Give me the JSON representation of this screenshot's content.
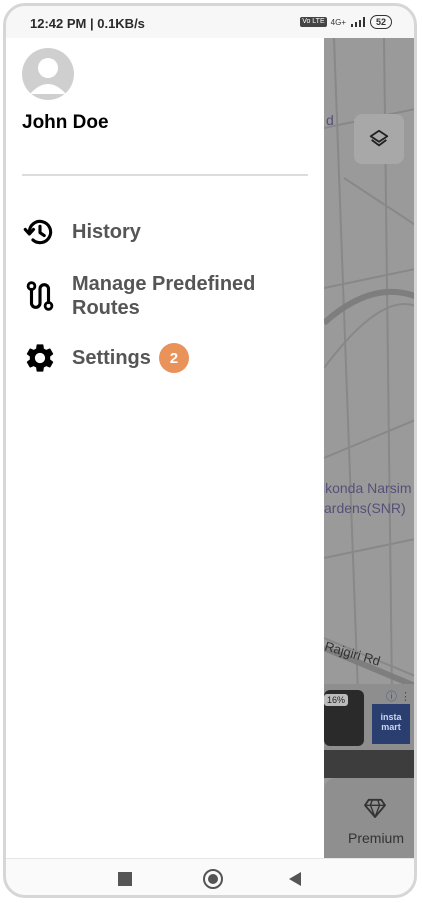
{
  "status_bar": {
    "time_speed": "12:42 PM | 0.1KB/s",
    "volte": "Vo LTE",
    "network": "4G+",
    "battery": "52"
  },
  "drawer": {
    "user_name": "John Doe",
    "menu": [
      {
        "label": "History",
        "icon": "history-icon"
      },
      {
        "label": "Manage Predefined Routes",
        "icon": "route-icon"
      },
      {
        "label": "Settings",
        "icon": "gear-icon",
        "badge": "2"
      }
    ]
  },
  "map": {
    "label_top": "d",
    "label_park_1": "lkonda Narsim",
    "label_park_2": "ardens(SNR)",
    "label_road": "Rajgiri Rd",
    "ad_badge": "16%",
    "ad_instamart": "insta mart",
    "premium_label": "Premium"
  },
  "colors": {
    "badge": "#e9925a",
    "menu_text": "#555555",
    "scrim": "#9a9a9a"
  }
}
